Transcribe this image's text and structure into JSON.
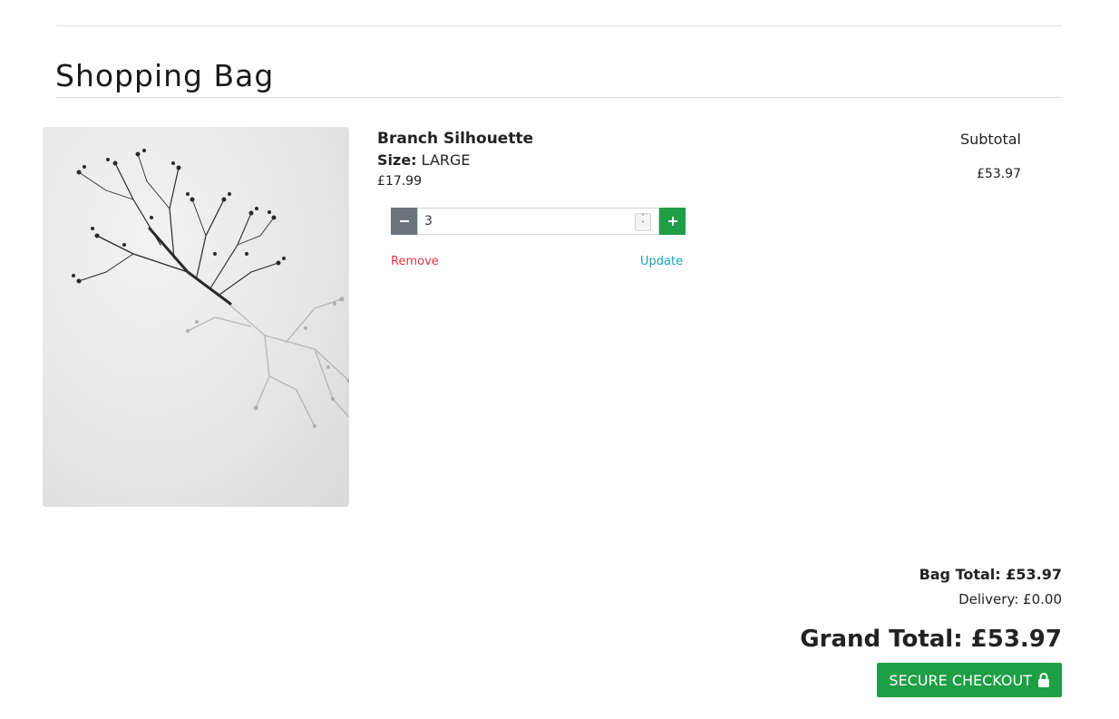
{
  "page": {
    "title": "Shopping Bag"
  },
  "item": {
    "name": "Branch Silhouette",
    "size_label": "Size:",
    "size_value": "LARGE",
    "price": "£17.99",
    "quantity": "3",
    "remove_label": "Remove",
    "update_label": "Update",
    "image_icon": "product-photo-branch",
    "minus_icon": "minus-icon",
    "plus_icon": "plus-icon"
  },
  "subtotal": {
    "header": "Subtotal",
    "value": "£53.97"
  },
  "totals": {
    "bag_total": "Bag Total: £53.97",
    "delivery": "Delivery: £0.00",
    "grand_total": "Grand Total: £53.97"
  },
  "checkout": {
    "label": "SECURE CHECKOUT",
    "icon": "lock-icon"
  },
  "colors": {
    "accent_green": "#1e9e45",
    "minus_gray": "#6c757d",
    "remove_red": "#dc3545",
    "update_teal": "#17a2b8"
  }
}
